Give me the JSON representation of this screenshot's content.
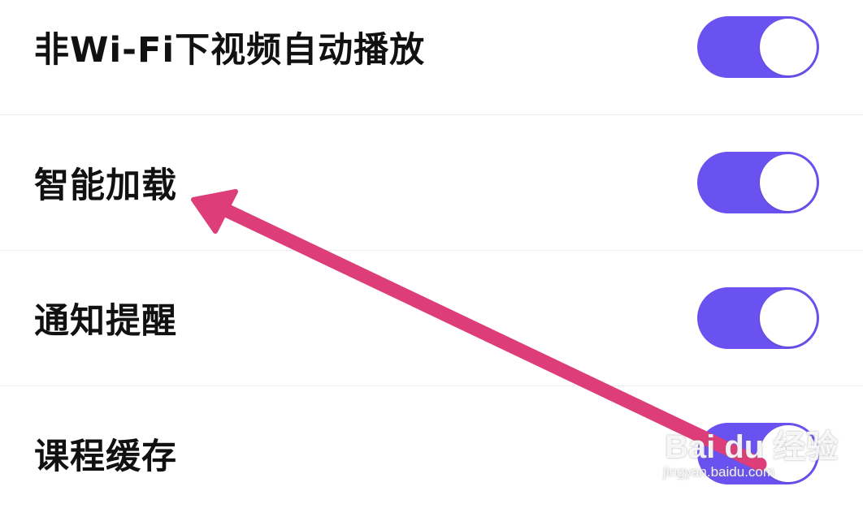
{
  "settings": [
    {
      "label": "非Wi-Fi下视频自动播放",
      "enabled": true
    },
    {
      "label": "智能加载",
      "enabled": true
    },
    {
      "label": "通知提醒",
      "enabled": true
    },
    {
      "label": "课程缓存",
      "enabled": true
    }
  ],
  "watermark": {
    "logo": "Bai du 经验",
    "url": "jingyan.baidu.com"
  },
  "colors": {
    "toggle_on": "#6a52f1",
    "arrow": "#dd3d78",
    "label": "#111111",
    "divider": "#ececec"
  }
}
